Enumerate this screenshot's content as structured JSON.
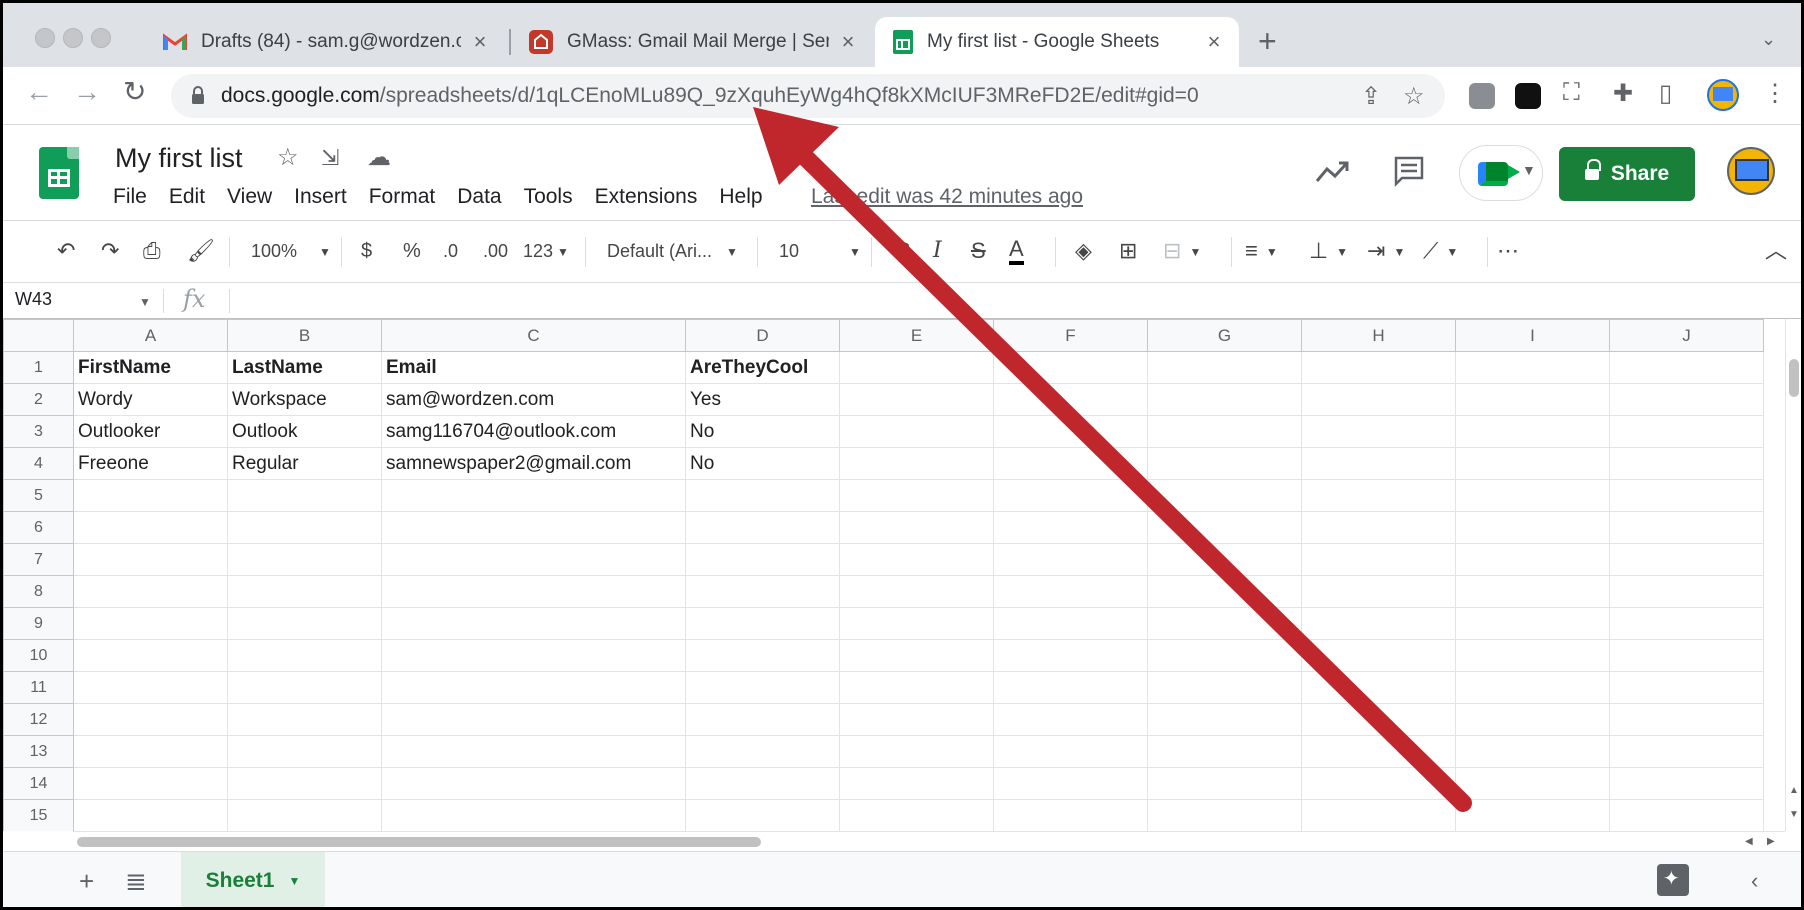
{
  "browser": {
    "tabs": [
      {
        "title": "Drafts (84) - sam.g@wordzen.c",
        "icon": "gmail-icon"
      },
      {
        "title": "GMass: Gmail Mail Merge | Sen",
        "icon": "gmass-icon"
      },
      {
        "title": "My first list - Google Sheets",
        "icon": "sheets-icon"
      }
    ],
    "url_host": "docs.google.com",
    "url_path": "/spreadsheets/d/1qLCEnoMLu89Q_9zXquhEyWg4hQf8kXMcIUF3MReFD2E/edit#gid=0"
  },
  "doc": {
    "title": "My first list",
    "menu": [
      "File",
      "Edit",
      "View",
      "Insert",
      "Format",
      "Data",
      "Tools",
      "Extensions",
      "Help"
    ],
    "last_edit": "Last edit was 42 minutes ago",
    "share_label": "Share"
  },
  "toolbar": {
    "zoom": "100%",
    "currency": "$",
    "percent": "%",
    "dec_decrease": ".0",
    "dec_increase": ".00",
    "more_formats": "123",
    "font": "Default (Ari...",
    "font_size": "10"
  },
  "formula_bar": {
    "name_box": "W43",
    "fx": "fx"
  },
  "grid": {
    "columns": [
      "A",
      "B",
      "C",
      "D",
      "E",
      "F",
      "G",
      "H",
      "I",
      "J"
    ],
    "rows": [
      {
        "n": "1",
        "cells": [
          "FirstName",
          "LastName",
          "Email",
          "AreTheyCool"
        ]
      },
      {
        "n": "2",
        "cells": [
          "Wordy",
          "Workspace",
          "sam@wordzen.com",
          "Yes"
        ]
      },
      {
        "n": "3",
        "cells": [
          "Outlooker",
          "Outlook",
          "samg116704@outlook.com",
          "No"
        ]
      },
      {
        "n": "4",
        "cells": [
          "Freeone",
          "Regular",
          "samnewspaper2@gmail.com",
          "No"
        ]
      },
      {
        "n": "5",
        "cells": []
      },
      {
        "n": "6",
        "cells": []
      },
      {
        "n": "7",
        "cells": []
      },
      {
        "n": "8",
        "cells": []
      },
      {
        "n": "9",
        "cells": []
      },
      {
        "n": "10",
        "cells": []
      },
      {
        "n": "11",
        "cells": []
      },
      {
        "n": "12",
        "cells": []
      },
      {
        "n": "13",
        "cells": []
      },
      {
        "n": "14",
        "cells": []
      },
      {
        "n": "15",
        "cells": []
      }
    ]
  },
  "sheets": [
    {
      "name": "Sheet1",
      "active": true
    }
  ],
  "colors": {
    "share_green": "#188038",
    "annotation_red": "#c0272d",
    "sheets_green": "#0f9d58"
  }
}
